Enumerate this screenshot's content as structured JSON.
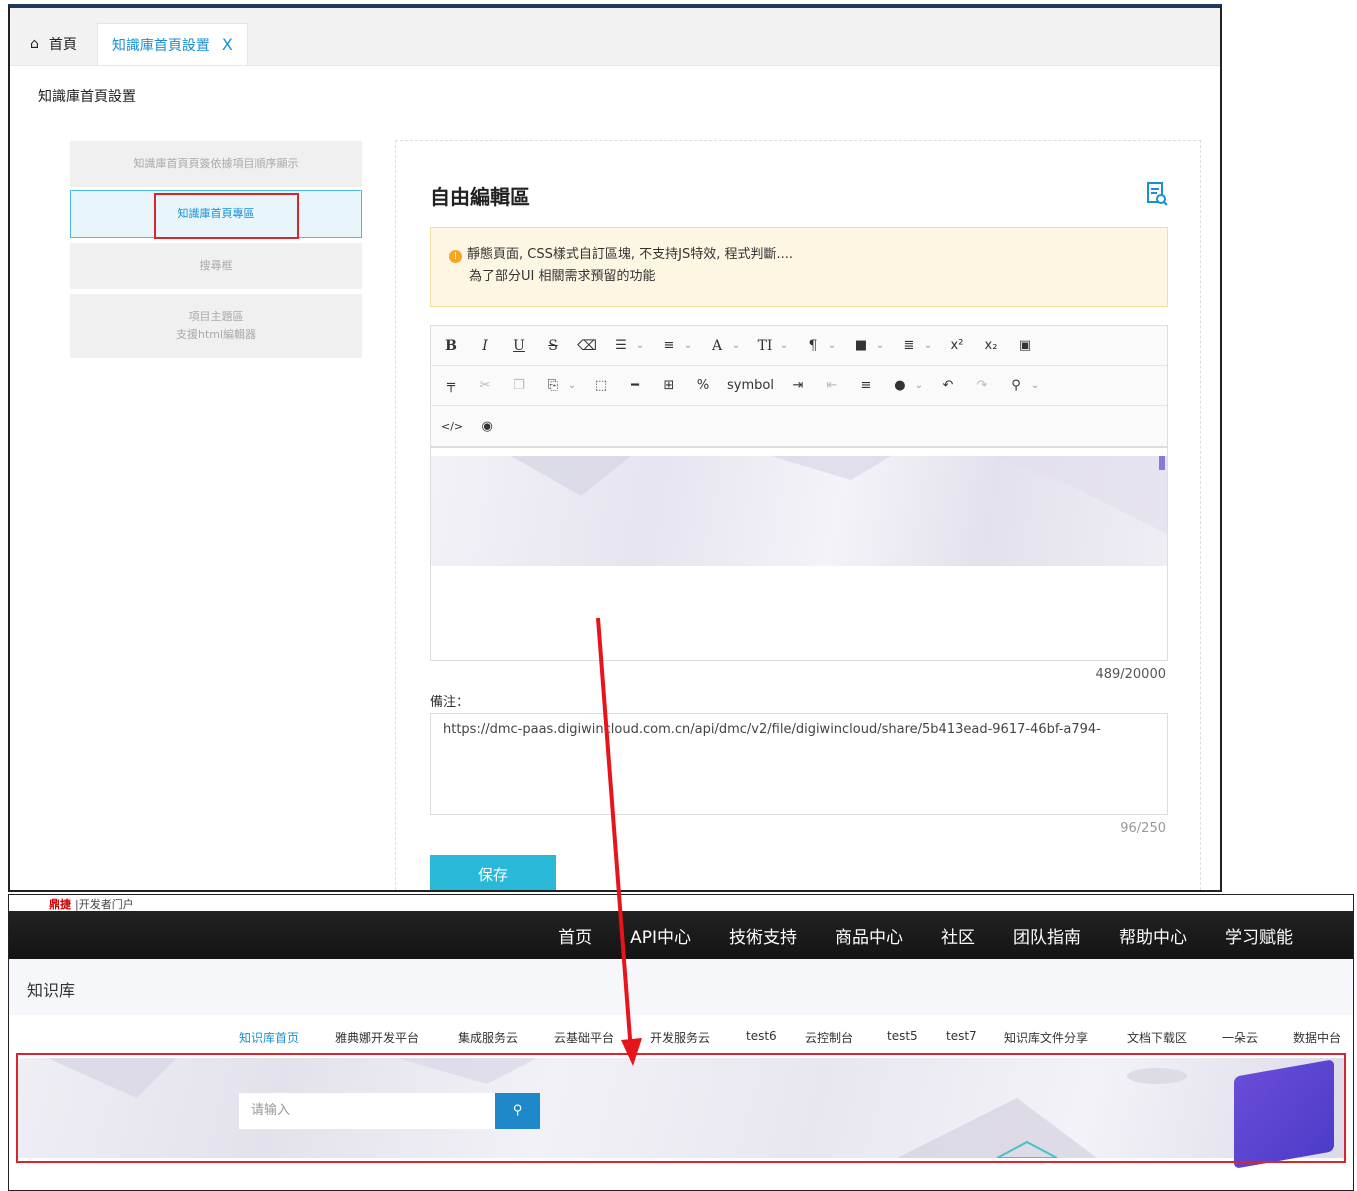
{
  "tabs": {
    "home_label": "首頁",
    "active_label": "知識庫首頁設置",
    "close_glyph": "X"
  },
  "page_title": "知識庫首頁設置",
  "menu": {
    "items": [
      {
        "label": "知識庫首頁頁簽依據項目順序顯示"
      },
      {
        "label": "知識庫首頁專區"
      },
      {
        "label": "搜尋框"
      },
      {
        "label_line1": "項目主題區",
        "label_line2": "支援html編輯器"
      }
    ]
  },
  "editor": {
    "title": "自由編輯區",
    "notice_line1": "靜態頁面, CSS樣式自訂區塊, 不支持JS特效, 程式判斷....",
    "notice_line2": "為了部分UI 相關需求預留的功能",
    "toolbar_symbol_label": "symbol",
    "char_count": "489/20000",
    "remark_label": "備注：",
    "remark_value": "https://dmc-paas.digiwincloud.com.cn/api/dmc/v2/file/digiwincloud/share/5b413ead-9617-46bf-a794-",
    "remark_count": "96/250",
    "save_label": "保存"
  },
  "portal": {
    "logo_text": "鼎捷",
    "logo_sub": "|开发者门户",
    "nav": [
      "首页",
      "API中心",
      "技術支持",
      "商品中心",
      "社区",
      "团队指南",
      "帮助中心",
      "学习赋能"
    ],
    "kb_title": "知识库",
    "subnav": [
      "知识库首页",
      "雅典娜开发平台",
      "集成服务云",
      "云基础平台",
      "开发服务云",
      "test6",
      "云控制台",
      "test5",
      "test7",
      "知识库文件分享",
      "文档下载区",
      "一朵云",
      "数据中台"
    ],
    "search_placeholder": "请输入"
  },
  "colors": {
    "accent": "#1a8fd6",
    "highlight": "#d9262c",
    "save": "#29b8d8",
    "notice_bg": "#fdf6e3"
  }
}
